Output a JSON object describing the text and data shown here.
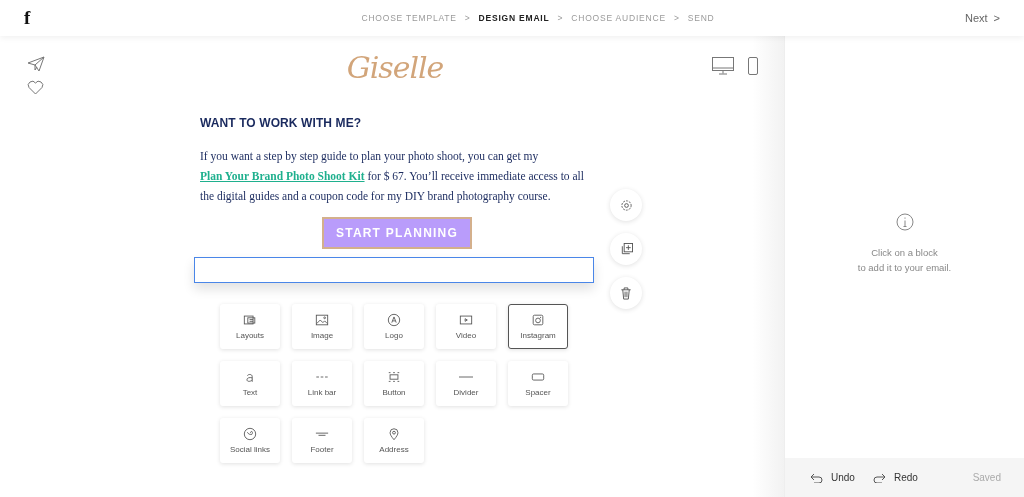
{
  "header": {
    "logo": "f",
    "steps": [
      {
        "label": "CHOOSE TEMPLATE",
        "selected": false
      },
      {
        "separator": ">",
        "label": "DESIGN EMAIL",
        "selected": true
      },
      {
        "separator": ">",
        "label": "CHOOSE AUDIENCE",
        "selected": false
      },
      {
        "separator": ">",
        "label": "SEND",
        "selected": false
      }
    ],
    "next": "Next",
    "next_icon": ">"
  },
  "email": {
    "brand": "Giselle",
    "heading": "WANT TO WORK WITH ME?",
    "text_before": "If you want a step by step guide to plan your photo shoot, you can get my ",
    "link": "Plan Your Brand Photo Shoot Kit",
    "text_after": " for $ 67. You’ll receive immediate access to all the digital guides and a coupon code for my DIY brand photography course.",
    "button": "START PLANNING",
    "empty_block_selected": true
  },
  "blocks": [
    {
      "kind": "layouts",
      "label": "Layouts",
      "selected": false
    },
    {
      "kind": "image",
      "label": "Image",
      "selected": false
    },
    {
      "kind": "logo",
      "label": "Logo",
      "selected": false
    },
    {
      "kind": "video",
      "label": "Video",
      "selected": false
    },
    {
      "kind": "instagram",
      "label": "Instagram",
      "selected": true
    },
    {
      "kind": "text",
      "label": "Text",
      "selected": false
    },
    {
      "kind": "linkbar",
      "label": "Link bar",
      "selected": false
    },
    {
      "kind": "button",
      "label": "Button",
      "selected": false
    },
    {
      "kind": "divider",
      "label": "Divider",
      "selected": false
    },
    {
      "kind": "spacer",
      "label": "Spacer",
      "selected": false
    },
    {
      "kind": "social",
      "label": "Social links",
      "selected": false
    },
    {
      "kind": "footer",
      "label": "Footer",
      "selected": false
    },
    {
      "kind": "address",
      "label": "Address",
      "selected": false
    }
  ],
  "side_panel": {
    "hint": [
      "Click on a block",
      "to add it to your email."
    ],
    "undo": "Undo",
    "redo": "Redo",
    "status": "Saved"
  }
}
